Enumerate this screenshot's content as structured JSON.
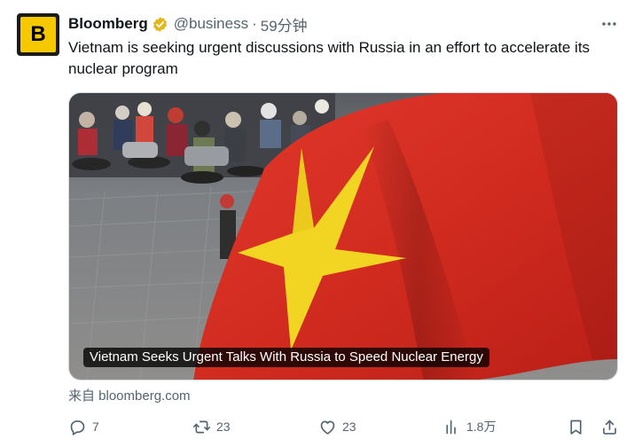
{
  "author": {
    "name": "Bloomberg",
    "avatar_letter": "B",
    "handle": "@business",
    "separator": "·",
    "time": "59分钟",
    "verified_color": "#e2b719"
  },
  "tweet": {
    "text": "Vietnam is seeking urgent discussions with Russia in an effort to accelerate its nuclear program"
  },
  "card": {
    "caption": "Vietnam Seeks Urgent Talks With Russia to Speed Nuclear Energy",
    "source": "来自 bloomberg.com"
  },
  "actions": {
    "replies": "7",
    "reposts": "23",
    "likes": "23",
    "views": "1.8万"
  },
  "colors": {
    "text": "#0f1419",
    "muted": "#536471",
    "flag_red": "#d42a1e",
    "flag_star": "#f2d422",
    "avatar_yellow": "#f5c800"
  },
  "icons": {
    "more": "more-dots-icon",
    "reply": "speech-bubble-icon",
    "repost": "repost-arrows-icon",
    "like": "heart-icon",
    "views": "bar-chart-icon",
    "bookmark": "bookmark-icon",
    "share": "share-upload-icon"
  }
}
